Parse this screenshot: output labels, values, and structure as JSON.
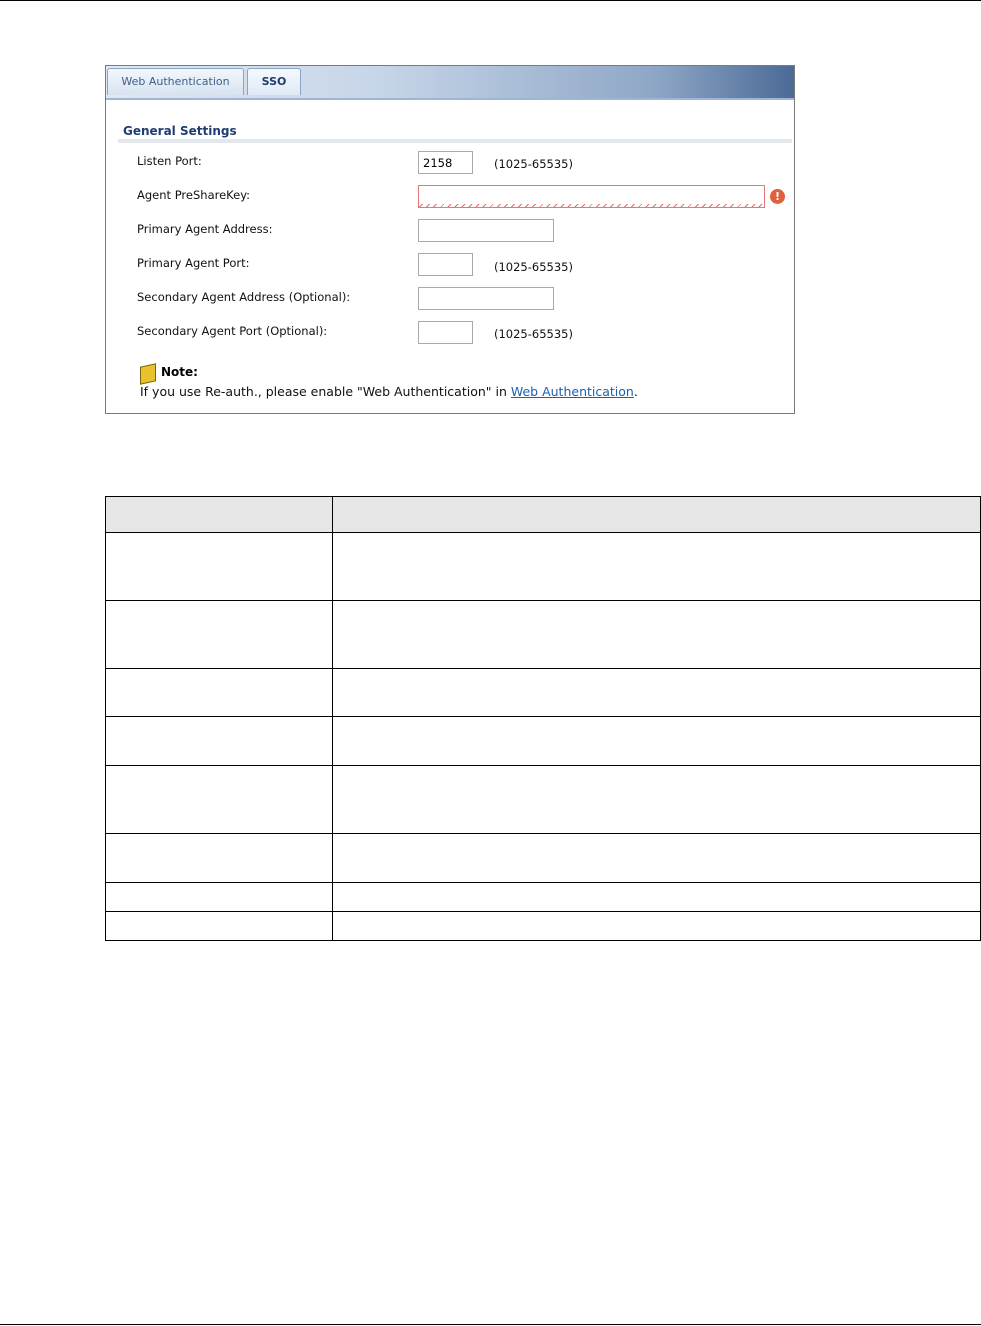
{
  "tabs": [
    {
      "label": "Web Authentication",
      "active": false
    },
    {
      "label": "SSO",
      "active": true
    }
  ],
  "section_title": "General Settings",
  "fields": {
    "listen_port": {
      "label": "Listen Port:",
      "value": "2158",
      "range": "(1025-65535)"
    },
    "agent_presharekey": {
      "label": "Agent PreShareKey:",
      "value": ""
    },
    "primary_agent_address": {
      "label": "Primary Agent Address:",
      "value": ""
    },
    "primary_agent_port": {
      "label": "Primary Agent Port:",
      "value": "",
      "range": "(1025-65535)"
    },
    "secondary_agent_address": {
      "label": "Secondary Agent Address (Optional):",
      "value": ""
    },
    "secondary_agent_port": {
      "label": "Secondary Agent Port (Optional):",
      "value": "",
      "range": "(1025-65535)"
    }
  },
  "error_icon": "exclamation-circle-icon",
  "note": {
    "icon": "note-icon",
    "title": "Note:",
    "text_before": "If you use Re-auth., please enable \"Web Authentication\" in ",
    "link": "Web Authentication",
    "text_after": "."
  },
  "colors": {
    "header_title": "#1f3c73",
    "error": "#e0623c",
    "link": "#1a5fb4"
  }
}
